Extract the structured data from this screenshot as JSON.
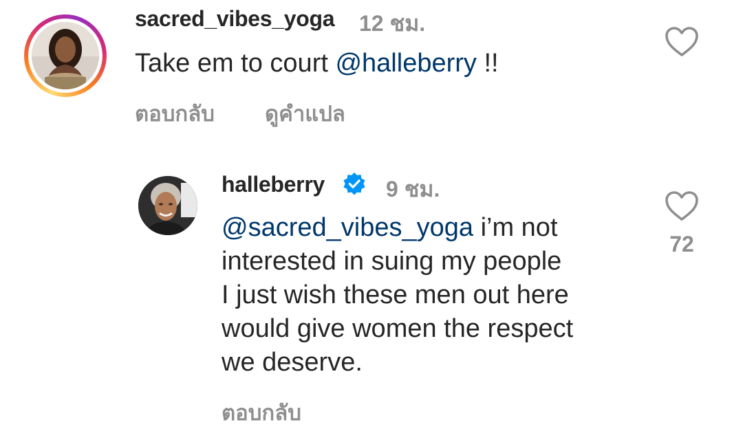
{
  "comments": [
    {
      "username": "sacred_vibes_yoga",
      "time": "12 ชม.",
      "text_mention": "@halleberry",
      "text_after": " !!",
      "text_before": "Take em to court ",
      "actions": {
        "reply": "ตอบกลับ",
        "translate": "ดูคำแปล"
      },
      "has_story_ring": true
    },
    {
      "username": "halleberry",
      "verified": true,
      "time": "9 ชม.",
      "likes": "72",
      "text_mention": "@sacred_vibes_yoga",
      "text_line1_rest": " i’m not",
      "text_lines": [
        "interested in suing my people",
        "I just wish these men out here",
        "would give women the respect",
        "we deserve."
      ],
      "actions": {
        "reply": "ตอบกลับ"
      }
    }
  ],
  "colors": {
    "primary_text": "#262626",
    "secondary_text": "#8e8e8e",
    "mention": "#00376b",
    "verified_badge": "#0095f6"
  },
  "icons": {
    "like": "heart-outline-icon",
    "verified": "verified-badge-icon"
  }
}
